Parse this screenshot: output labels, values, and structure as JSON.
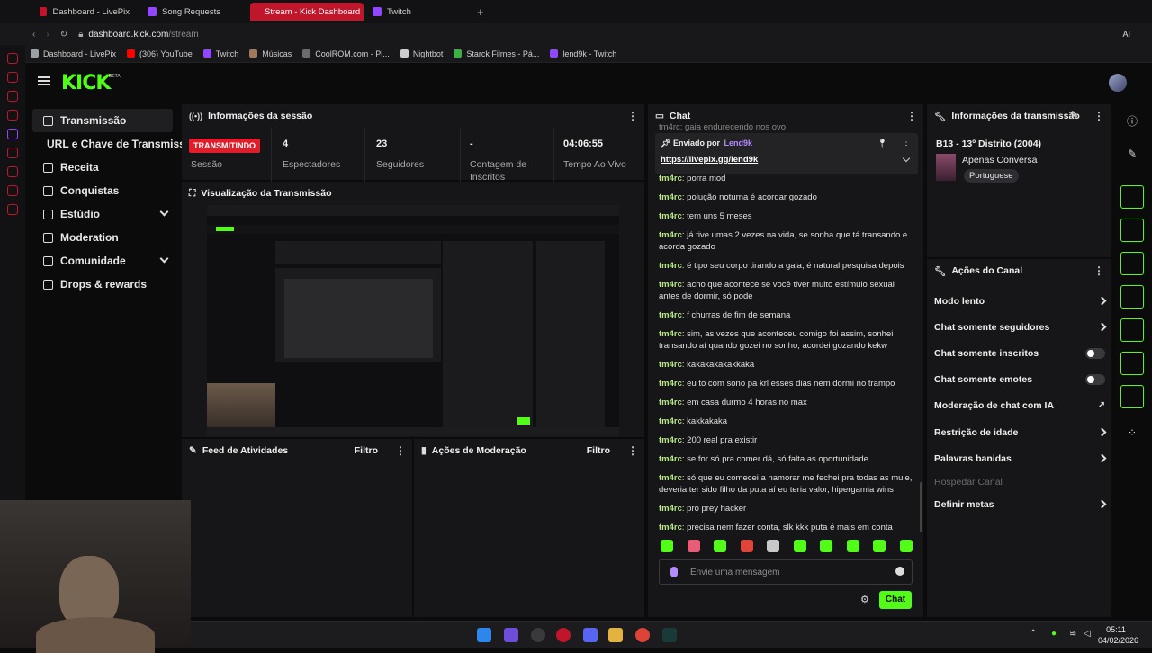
{
  "browser": {
    "tabs": [
      {
        "label": "Dashboard - LivePix",
        "color": "#c0162c"
      },
      {
        "label": "Song Requests",
        "color": "#9146ff"
      },
      {
        "label": "Stream - Kick Dashboard",
        "color": "#53fc18"
      },
      {
        "label": "Twitch",
        "color": "#9146ff"
      }
    ],
    "url_host": "dashboard.kick.com",
    "url_path": "/stream",
    "ai_label": "AI",
    "bookmarks": [
      {
        "label": "Dashboard - LivePix",
        "color": "#9aa0a6"
      },
      {
        "label": "(306) YouTube",
        "color": "#ff0000"
      },
      {
        "label": "Twitch",
        "color": "#9146ff"
      },
      {
        "label": "Músicas",
        "color": "#a0785a"
      },
      {
        "label": "CoolROM.com - Pl...",
        "color": "#6b6b6b"
      },
      {
        "label": "Nightbot",
        "color": "#cccccc"
      },
      {
        "label": "Starck Filmes - Pá...",
        "color": "#3cb043"
      },
      {
        "label": "lend9k - Twitch",
        "color": "#9146ff"
      }
    ]
  },
  "kick": {
    "logo": "KICK",
    "beta": "BETA",
    "nav": [
      {
        "label": "Transmissão",
        "icon": "broadcast-icon",
        "active": true
      },
      {
        "label": "URL e Chave de Transmissão",
        "icon": "",
        "active": false
      },
      {
        "label": "Receita",
        "icon": "chart-icon",
        "active": false
      },
      {
        "label": "Conquistas",
        "icon": "trophy-icon",
        "active": false
      },
      {
        "label": "Estúdio",
        "icon": "studio-icon",
        "active": false
      },
      {
        "label": "Moderation",
        "icon": "wrench-icon",
        "active": false
      },
      {
        "label": "Comunidade",
        "icon": "community-icon",
        "active": false
      },
      {
        "label": "Drops & rewards",
        "icon": "drops-icon",
        "active": false
      }
    ]
  },
  "session": {
    "title": "Informações da sessão",
    "live_badge": "TRANSMITINDO",
    "session_label": "Sessão",
    "stats": [
      {
        "value": "4",
        "label": "Espectadores"
      },
      {
        "value": "23",
        "label": "Seguidores"
      },
      {
        "value": "-",
        "label": "Contagem de Inscritos"
      },
      {
        "value": "04:06:55",
        "label": "Tempo Ao Vivo"
      }
    ]
  },
  "preview": {
    "title": "Visualização da Transmissão"
  },
  "activity": {
    "title": "Feed de Atividades",
    "filter": "Filtro"
  },
  "modactions": {
    "title": "Ações de Moderação",
    "filter": "Filtro"
  },
  "chat": {
    "title": "Chat",
    "pinned_header": "Enviado por",
    "pinned_user": "Lend9k",
    "pinned_link": "https://livepix.gg/lend9k",
    "top_cut": "tm4rc: gaia endurecendo nos ovo",
    "messages": [
      {
        "user": "tm4rc",
        "text": "porra mod"
      },
      {
        "user": "tm4rc",
        "text": "polução noturna é acordar gozado"
      },
      {
        "user": "tm4rc",
        "text": "tem uns 5 meses"
      },
      {
        "user": "tm4rc",
        "text": "já tive umas 2 vezes na vida, se sonha que tá transando e acorda gozado"
      },
      {
        "user": "tm4rc",
        "text": "é tipo seu corpo tirando a gala, é natural pesquisa depois"
      },
      {
        "user": "tm4rc",
        "text": "acho que acontece se você tiver muito estímulo sexual antes de dormir, só pode"
      },
      {
        "user": "tm4rc",
        "text": "f churras de fim de semana"
      },
      {
        "user": "tm4rc",
        "text": "sim, as vezes que aconteceu comigo foi assim, sonhei transando aí quando gozei no sonho, acordei gozando kekw"
      },
      {
        "user": "tm4rc",
        "text": "kakakakakakkaka"
      },
      {
        "user": "tm4rc",
        "text": "eu to com sono pa krl esses dias nem dormi no trampo"
      },
      {
        "user": "tm4rc",
        "text": "em casa durmo 4 horas no max"
      },
      {
        "user": "tm4rc",
        "text": "kakkakaka"
      },
      {
        "user": "tm4rc",
        "text": "200 real pra existir"
      },
      {
        "user": "tm4rc",
        "text": "se for só pra comer dá, só falta as oportunidade"
      },
      {
        "user": "tm4rc",
        "text": "só que eu comecei a namorar me fechei pra todas as muie, deveria ter sido filho da puta aí eu teria valor, hipergamia wins"
      },
      {
        "user": "tm4rc",
        "text": "pro prey hacker"
      },
      {
        "user": "tm4rc",
        "text": "precisa nem fazer conta, slk kkk puta é mais em conta"
      }
    ],
    "placeholder": "Envie uma mensagem",
    "send_label": "Chat"
  },
  "stream_info": {
    "title": "Informações da transmissão",
    "stream_title": "B13 - 13º Distrito (2004)",
    "category": "Apenas Conversa",
    "language": "Portuguese"
  },
  "channel_actions": {
    "title": "Ações do Canal",
    "items": [
      {
        "label": "Modo lento",
        "kind": "chevron"
      },
      {
        "label": "Chat somente seguidores",
        "kind": "chevron"
      },
      {
        "label": "Chat somente inscritos",
        "kind": "toggle"
      },
      {
        "label": "Chat somente emotes",
        "kind": "toggle"
      },
      {
        "label": "Moderação de chat com IA",
        "kind": "external"
      },
      {
        "label": "Restrição de idade",
        "kind": "chevron"
      },
      {
        "label": "Palavras banidas",
        "kind": "chevron"
      },
      {
        "label": "Hospedar Canal",
        "kind": "disabled"
      },
      {
        "label": "Definir metas",
        "kind": "chevron"
      }
    ]
  },
  "taskbar": {
    "time": "05:11",
    "date": "04/02/2026"
  },
  "colors": {
    "accent": "#53fc18",
    "live": "#e11d2b",
    "panel": "#161618"
  }
}
